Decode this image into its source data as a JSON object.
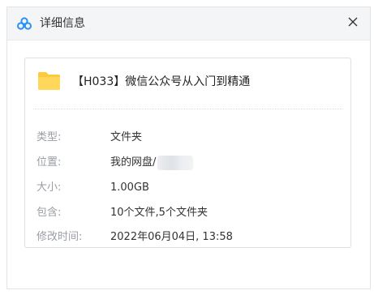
{
  "window": {
    "title": "详细信息",
    "icons": {
      "app": "cloud-drive-logo-icon",
      "close": "close-icon",
      "item": "folder-icon"
    }
  },
  "item": {
    "name": "【H033】微信公众号从入门到精通"
  },
  "details": {
    "type": {
      "label": "类型:",
      "value": "文件夹"
    },
    "location": {
      "label": "位置:",
      "value": "我的网盘/"
    },
    "size": {
      "label": "大小:",
      "value": "1.00GB"
    },
    "contains": {
      "label": "包含:",
      "value": "10个文件,5个文件夹"
    },
    "modified": {
      "label": "修改时间:",
      "value": "2022年06月04日, 13:58"
    }
  },
  "colors": {
    "accent": "#2a8ff7",
    "folder": "#ffc93c",
    "label": "#9a9ea4",
    "text": "#333333"
  }
}
